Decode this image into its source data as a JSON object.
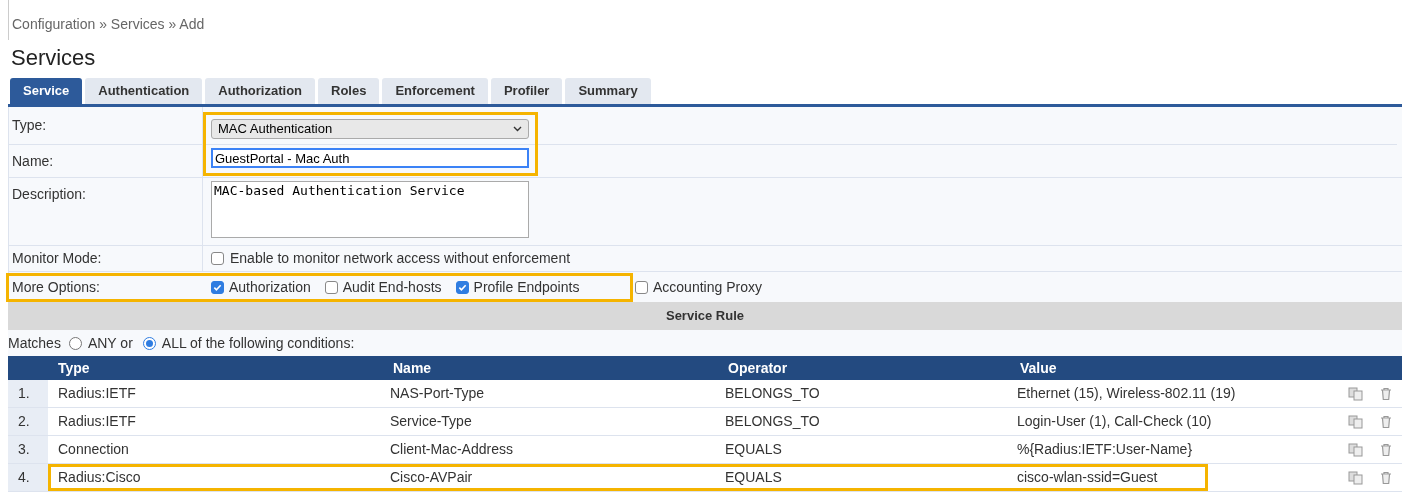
{
  "breadcrumb": "Configuration » Services » Add",
  "title": "Services",
  "tabs": [
    {
      "label": "Service",
      "selected": true
    },
    {
      "label": "Authentication",
      "selected": false
    },
    {
      "label": "Authorization",
      "selected": false
    },
    {
      "label": "Roles",
      "selected": false
    },
    {
      "label": "Enforcement",
      "selected": false
    },
    {
      "label": "Profiler",
      "selected": false
    },
    {
      "label": "Summary",
      "selected": false
    }
  ],
  "form": {
    "type": {
      "label": "Type:",
      "value": "MAC Authentication"
    },
    "name": {
      "label": "Name:",
      "value": "GuestPortal - Mac Auth"
    },
    "description": {
      "label": "Description:",
      "value": "MAC-based Authentication Service"
    },
    "monitor_mode": {
      "label": "Monitor Mode:",
      "text": "Enable to monitor network access without enforcement",
      "checked": false
    },
    "more_options": {
      "label": "More Options:",
      "options": [
        {
          "label": "Authorization",
          "checked": true
        },
        {
          "label": "Audit End-hosts",
          "checked": false
        },
        {
          "label": "Profile Endpoints",
          "checked": true
        },
        {
          "label": "Accounting Proxy",
          "checked": false
        }
      ]
    }
  },
  "service_rule": {
    "header": "Service Rule",
    "matches_label": "Matches",
    "match_options": [
      {
        "label": "ANY or",
        "selected": false
      },
      {
        "label": "ALL of the following conditions:",
        "selected": true
      }
    ],
    "columns": [
      "Type",
      "Name",
      "Operator",
      "Value"
    ],
    "rows": [
      {
        "index": "1.",
        "type": "Radius:IETF",
        "name": "NAS-Port-Type",
        "operator": "BELONGS_TO",
        "value": "Ethernet (15), Wireless-802.11 (19)",
        "highlighted": false
      },
      {
        "index": "2.",
        "type": "Radius:IETF",
        "name": "Service-Type",
        "operator": "BELONGS_TO",
        "value": "Login-User (1), Call-Check (10)",
        "highlighted": false
      },
      {
        "index": "3.",
        "type": "Connection",
        "name": "Client-Mac-Address",
        "operator": "EQUALS",
        "value": "%{Radius:IETF:User-Name}",
        "highlighted": false
      },
      {
        "index": "4.",
        "type": "Radius:Cisco",
        "name": "Cisco-AVPair",
        "operator": "EQUALS",
        "value": "cisco-wlan-ssid=Guest",
        "highlighted": true
      }
    ]
  }
}
